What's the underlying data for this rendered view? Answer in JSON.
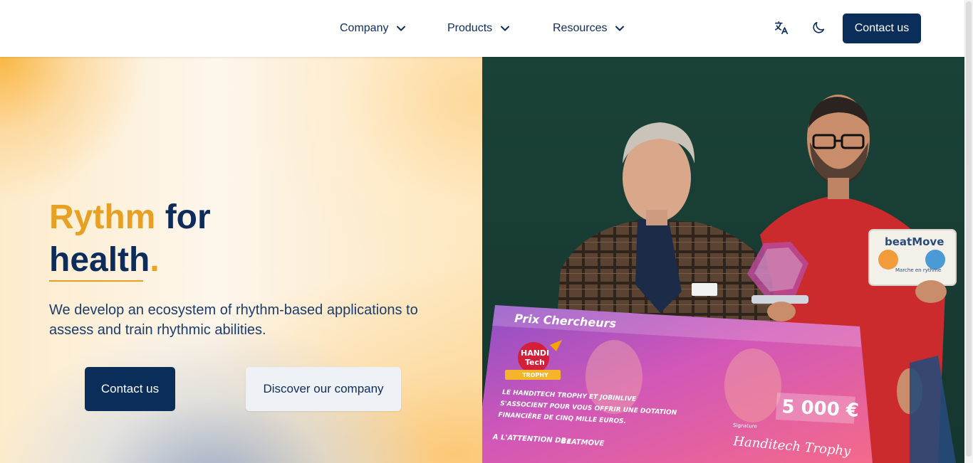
{
  "nav": {
    "items": [
      {
        "label": "Company",
        "icon": "chevron-down-icon"
      },
      {
        "label": "Products",
        "icon": "chevron-down-icon"
      },
      {
        "label": "Resources",
        "icon": "chevron-down-icon"
      }
    ],
    "language_icon": "translate-icon",
    "theme_icon": "moon-icon",
    "cta_label": "Contact us"
  },
  "hero": {
    "headline_part1": "Rythm",
    "headline_part2": "for",
    "headline_part3": "health",
    "headline_dot": ".",
    "subtitle": "We develop an ecosystem of rhythm-based applications to assess and train rhythmic abilities.",
    "primary_button": "Contact us",
    "secondary_button": "Discover our company"
  },
  "photo": {
    "cheque_title": "Prix Chercheurs",
    "logo_text_1": "HANDI",
    "logo_text_2": "Tech",
    "logo_text_3": "TROPHY",
    "cheque_line_1": "LE HANDITECH TROPHY ET JOBINLIVE",
    "cheque_line_2": "S'ASSOCIENT POUR VOUS OFFRIR UNE DOTATION",
    "cheque_line_3": "FINANCIÈRE DE CINQ MILLE EUROS.",
    "attention_label": "A L'ATTENTION DE :",
    "attention_value": "BEATMOVE",
    "amount": "5 000 €",
    "signature_label": "Signature",
    "signature": "Handitech Trophy",
    "box_brand": "beatMove",
    "box_sub": "Marche en rythme"
  },
  "colors": {
    "navy": "#0b2d5a",
    "accent_orange": "#e8a024",
    "secondary_button_bg": "#eef2f7"
  }
}
